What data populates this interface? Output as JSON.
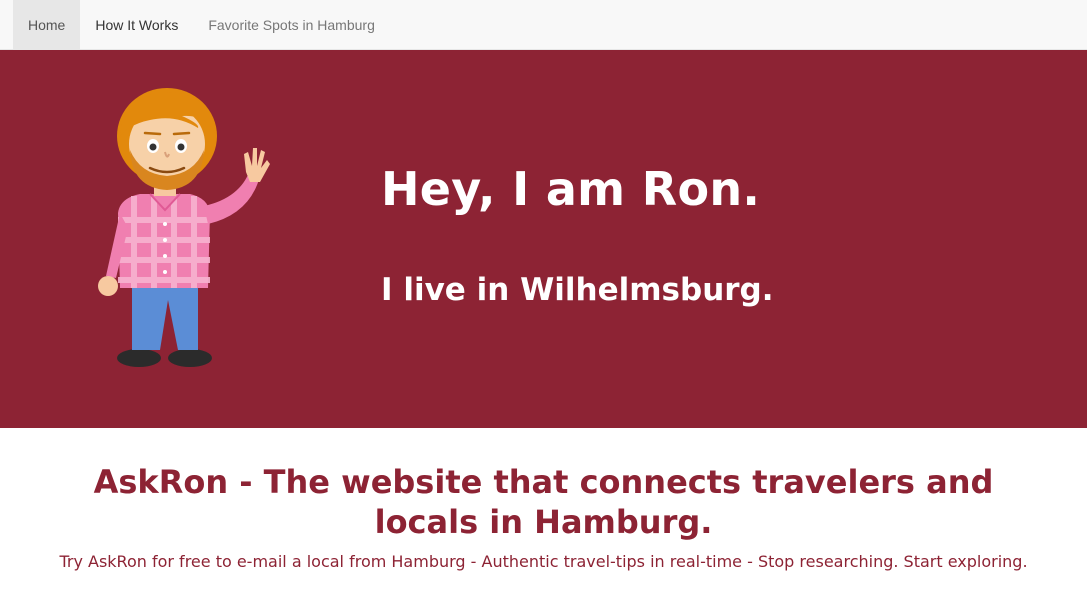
{
  "nav": {
    "items": [
      {
        "label": "Home",
        "active": true
      },
      {
        "label": "How It Works",
        "active": false
      },
      {
        "label": "Favorite Spots in Hamburg",
        "active": false
      }
    ]
  },
  "hero": {
    "headline": "Hey, I am Ron.",
    "subline": "I live in Wilhelmsburg.",
    "background_color": "#8d2334",
    "illustration": "waving-man-icon"
  },
  "intro": {
    "title": "AskRon - The website that connects travelers and locals in Hamburg.",
    "text": "Try AskRon for free to e-mail a local from Hamburg - Authentic travel-tips in real-time - Stop researching. Start exploring.",
    "accent_color": "#8d2334"
  }
}
